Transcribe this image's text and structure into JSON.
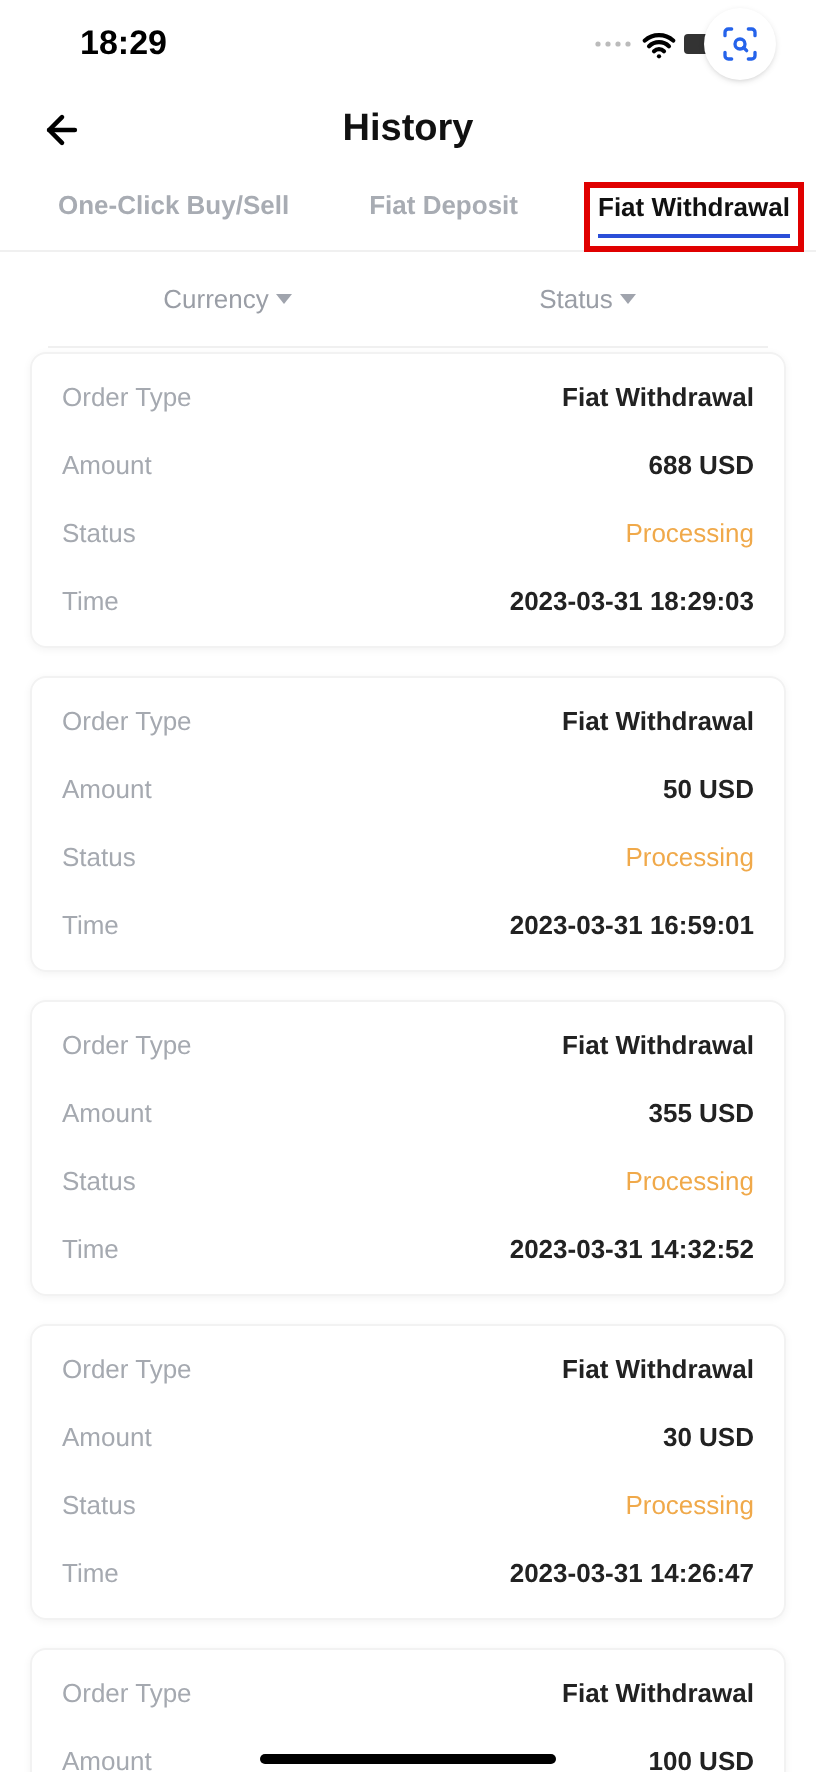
{
  "status_bar": {
    "time": "18:29"
  },
  "header": {
    "title": "History"
  },
  "tabs": [
    {
      "label": "One-Click Buy/Sell",
      "selected": false,
      "highlighted": false
    },
    {
      "label": "Fiat Deposit",
      "selected": false,
      "highlighted": false
    },
    {
      "label": "Fiat Withdrawal",
      "selected": true,
      "highlighted": true
    }
  ],
  "filters": [
    {
      "label": "Currency"
    },
    {
      "label": "Status"
    }
  ],
  "orders": [
    {
      "rows": [
        {
          "label": "Order Type",
          "value": "Fiat Withdrawal",
          "kind": "plain"
        },
        {
          "label": "Amount",
          "value": "688 USD",
          "kind": "plain"
        },
        {
          "label": "Status",
          "value": "Processing",
          "kind": "status"
        },
        {
          "label": "Time",
          "value": "2023-03-31 18:29:03",
          "kind": "plain"
        }
      ]
    },
    {
      "rows": [
        {
          "label": "Order Type",
          "value": "Fiat Withdrawal",
          "kind": "plain"
        },
        {
          "label": "Amount",
          "value": "50 USD",
          "kind": "plain"
        },
        {
          "label": "Status",
          "value": "Processing",
          "kind": "status"
        },
        {
          "label": "Time",
          "value": "2023-03-31 16:59:01",
          "kind": "plain"
        }
      ]
    },
    {
      "rows": [
        {
          "label": "Order Type",
          "value": "Fiat Withdrawal",
          "kind": "plain"
        },
        {
          "label": "Amount",
          "value": "355 USD",
          "kind": "plain"
        },
        {
          "label": "Status",
          "value": "Processing",
          "kind": "status"
        },
        {
          "label": "Time",
          "value": "2023-03-31 14:32:52",
          "kind": "plain"
        }
      ]
    },
    {
      "rows": [
        {
          "label": "Order Type",
          "value": "Fiat Withdrawal",
          "kind": "plain"
        },
        {
          "label": "Amount",
          "value": "30 USD",
          "kind": "plain"
        },
        {
          "label": "Status",
          "value": "Processing",
          "kind": "status"
        },
        {
          "label": "Time",
          "value": "2023-03-31 14:26:47",
          "kind": "plain"
        }
      ]
    },
    {
      "rows": [
        {
          "label": "Order Type",
          "value": "Fiat Withdrawal",
          "kind": "plain"
        },
        {
          "label": "Amount",
          "value": "100 USD",
          "kind": "plain"
        }
      ]
    }
  ]
}
